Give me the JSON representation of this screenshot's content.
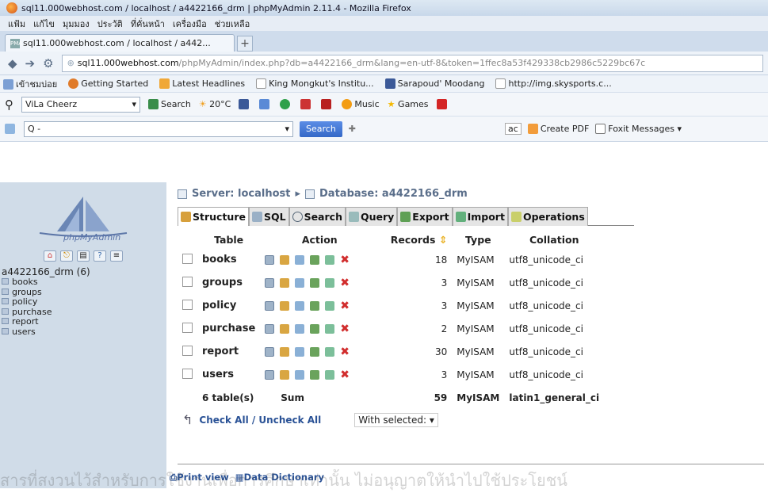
{
  "window_title": "sql11.000webhost.com / localhost / a4422166_drm | phpMyAdmin 2.11.4 - Mozilla Firefox",
  "menu": [
    "แฟ้ม",
    "แก้ไข",
    "มุมมอง",
    "ประวัติ",
    "ที่คั่นหน้า",
    "เครื่องมือ",
    "ช่วยเหลือ"
  ],
  "tab_label": "sql11.000webhost.com / localhost / a442...",
  "url": {
    "host": "sql11.000webhost.com",
    "path": "/phpMyAdmin/index.php?db=a4422166_drm&lang=en-utf-8&token=1ffec8a53f429338cb2986c5229bc67c"
  },
  "bookmarks": [
    "เข้าชมบ่อย",
    "Getting Started",
    "Latest Headlines",
    "King Mongkut's Institu...",
    "Sarapoud' Moodang",
    "http://img.skysports.c..."
  ],
  "toolbar1": {
    "combo": "ViLa Cheerz",
    "search": "Search",
    "weather": "20°C",
    "music": "Music",
    "games": "Games"
  },
  "toolbar2": {
    "combo": "Q -",
    "search": "Search",
    "create_pdf": "Create PDF",
    "foxit": "Foxit Messages",
    "ac": "ac"
  },
  "logo_text": "phpMyAdmin",
  "db_name": "a4422166_drm (6)",
  "tables_left": [
    "books",
    "groups",
    "policy",
    "purchase",
    "report",
    "users"
  ],
  "breadcrumb": {
    "server": "Server: localhost",
    "database": "Database: a4422166_drm"
  },
  "tabs": [
    "Structure",
    "SQL",
    "Search",
    "Query",
    "Export",
    "Import",
    "Operations"
  ],
  "headers": {
    "table": "Table",
    "action": "Action",
    "records": "Records",
    "type": "Type",
    "collation": "Collation"
  },
  "rows": [
    {
      "name": "books",
      "records": "18",
      "type": "MyISAM",
      "collation": "utf8_unicode_ci"
    },
    {
      "name": "groups",
      "records": "3",
      "type": "MyISAM",
      "collation": "utf8_unicode_ci"
    },
    {
      "name": "policy",
      "records": "3",
      "type": "MyISAM",
      "collation": "utf8_unicode_ci"
    },
    {
      "name": "purchase",
      "records": "2",
      "type": "MyISAM",
      "collation": "utf8_unicode_ci"
    },
    {
      "name": "report",
      "records": "30",
      "type": "MyISAM",
      "collation": "utf8_unicode_ci"
    },
    {
      "name": "users",
      "records": "3",
      "type": "MyISAM",
      "collation": "utf8_unicode_ci"
    }
  ],
  "summary": {
    "tables": "6 table(s)",
    "sum": "Sum",
    "records": "59",
    "type": "MyISAM",
    "collation": "latin1_general_ci"
  },
  "check_all": "Check All / Uncheck All",
  "with_selected": "With selected:",
  "footer": {
    "print": "Print view",
    "dict": "Data Dictionary"
  },
  "watermark": "สารที่สงวนไว้สำหรับการใช้งานเพื่อการศึกษาเท่านั้น ไม่อนุญาตให้นำไปใช้ประโยชน์"
}
